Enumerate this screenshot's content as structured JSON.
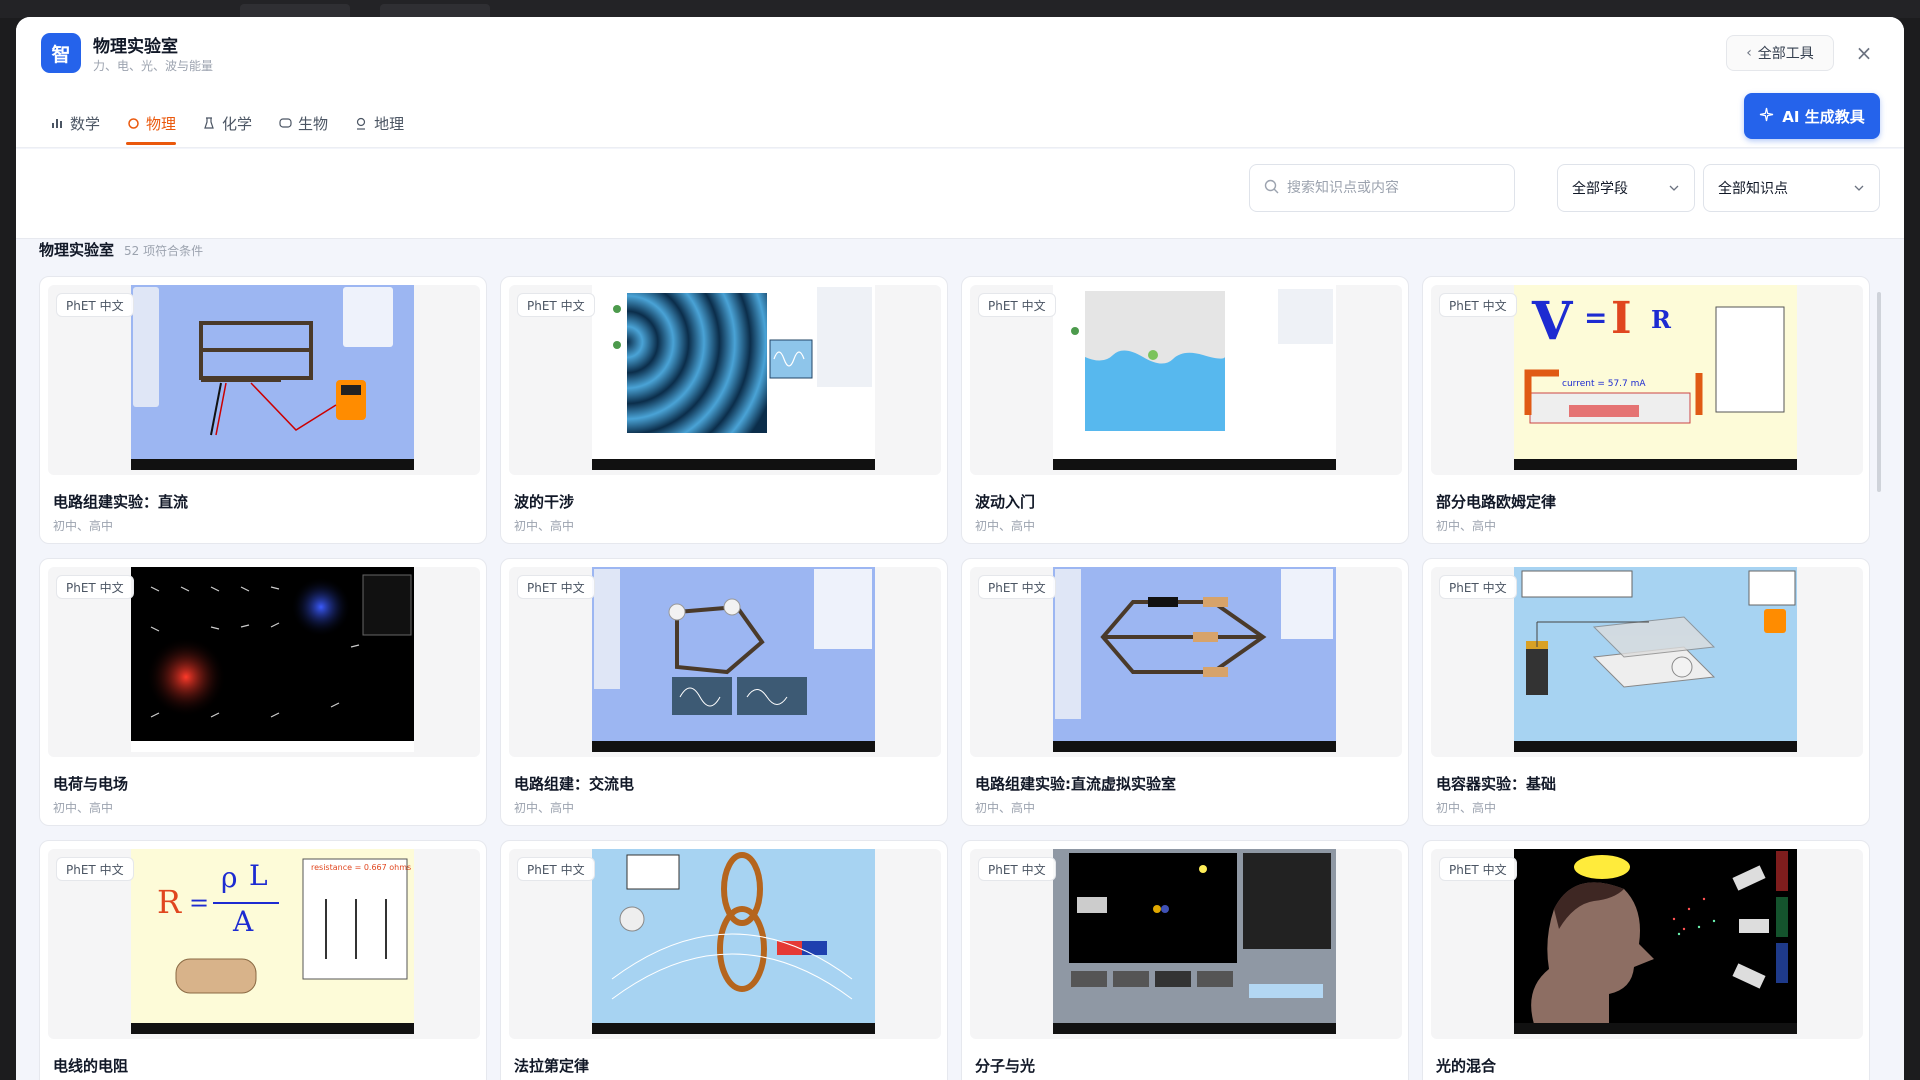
{
  "app": {
    "logo_char": "智",
    "title": "物理实验室",
    "subtitle": "力、电、光、波与能量",
    "all_tools": "全部工具"
  },
  "tabs": [
    {
      "label": "数学",
      "icon": "bar-chart-icon",
      "active": false
    },
    {
      "label": "物理",
      "icon": "atom-icon",
      "active": true
    },
    {
      "label": "化学",
      "icon": "flask-icon",
      "active": false
    },
    {
      "label": "生物",
      "icon": "leaf-icon",
      "active": false
    },
    {
      "label": "地理",
      "icon": "map-pin-icon",
      "active": false
    }
  ],
  "ai_button": "AI 生成教具",
  "filters": {
    "search_placeholder": "搜索知识点或内容",
    "stage": "全部学段",
    "topic": "全部知识点"
  },
  "section": {
    "title": "物理实验室",
    "count": "52 项符合条件"
  },
  "badge": "PhET 中文",
  "cards": [
    {
      "title": "电路组建实验：直流",
      "levels": "初中、高中",
      "thumb": "circuit-dc"
    },
    {
      "title": "波的干涉",
      "levels": "初中、高中",
      "thumb": "wave-interference"
    },
    {
      "title": "波动入门",
      "levels": "初中、高中",
      "thumb": "waves-intro"
    },
    {
      "title": "部分电路欧姆定律",
      "levels": "初中、高中",
      "thumb": "ohms-law"
    },
    {
      "title": "电荷与电场",
      "levels": "初中、高中",
      "thumb": "charges-fields"
    },
    {
      "title": "电路组建：交流电",
      "levels": "初中、高中",
      "thumb": "circuit-ac"
    },
    {
      "title": "电路组建实验:直流虚拟实验室",
      "levels": "初中、高中",
      "thumb": "circuit-virtual"
    },
    {
      "title": "电容器实验：基础",
      "levels": "初中、高中",
      "thumb": "capacitor"
    },
    {
      "title": "电线的电阻",
      "levels": "",
      "thumb": "resistance"
    },
    {
      "title": "法拉第定律",
      "levels": "",
      "thumb": "faraday"
    },
    {
      "title": "分子与光",
      "levels": "",
      "thumb": "molecules-light"
    },
    {
      "title": "光的混合",
      "levels": "",
      "thumb": "color-vision"
    }
  ],
  "thumb_text": {
    "ohm_formula_v": "V",
    "ohm_formula_eq": "=",
    "ohm_formula_i": "I",
    "ohm_formula_r": "R",
    "ohm_current": "current = 57.7 mA",
    "res_r": "R",
    "res_eq": "=",
    "res_rho": "ρ",
    "res_l": "L",
    "res_a": "A",
    "res_label": "resistance = 0.667 ohms"
  }
}
